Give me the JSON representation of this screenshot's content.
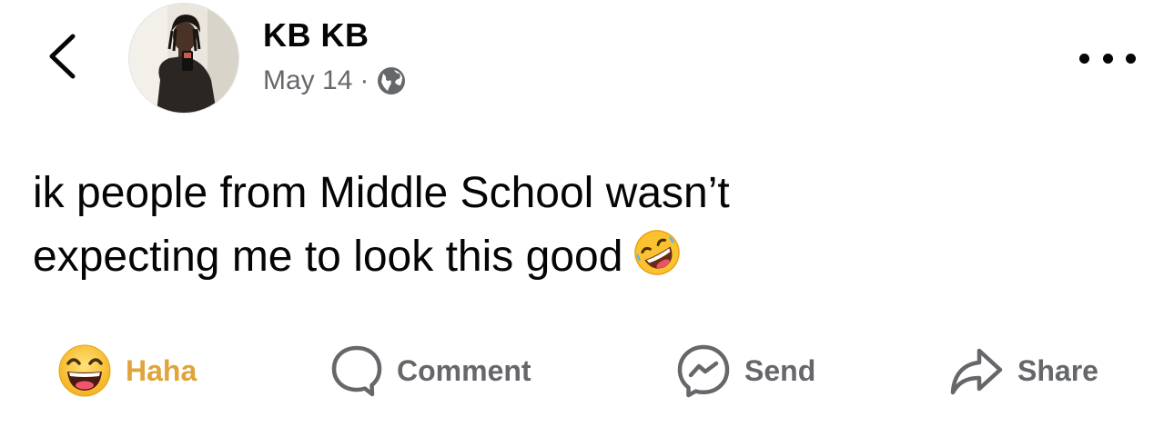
{
  "author": {
    "name": "KB KB",
    "date": "May 14",
    "separator": "·",
    "privacy_icon": "globe-icon",
    "avatar_alt": "profile-photo"
  },
  "header": {
    "back_icon": "chevron-left-icon",
    "more_icon": "more-horizontal-icon"
  },
  "post": {
    "text_line1": "ik people from Middle School wasn’t",
    "text_line2": "expecting me to look this good",
    "emoji": "rolling-on-floor-laughing-emoji"
  },
  "actions": {
    "reaction_label": "Haha",
    "reaction_icon": "haha-reaction-icon",
    "reaction_color": "#e0a43a",
    "comment_label": "Comment",
    "comment_icon": "comment-icon",
    "send_label": "Send",
    "send_icon": "messenger-icon",
    "share_label": "Share",
    "share_icon": "share-arrow-icon"
  },
  "colors": {
    "text_primary": "#050505",
    "text_secondary": "#65676b",
    "background": "#ffffff"
  }
}
